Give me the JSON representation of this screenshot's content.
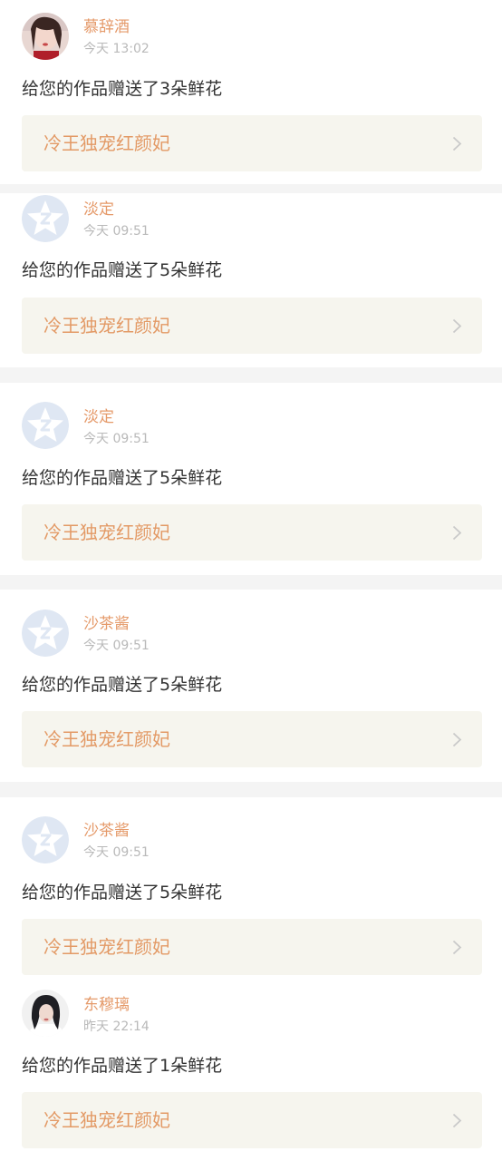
{
  "notifications": [
    {
      "username": "慕辞酒",
      "time": "今天 13:02",
      "message": "给您的作品赠送了3朵鲜花",
      "work_title": "冷王独宠红颜妃",
      "avatar": "photo-avatar-icon"
    },
    {
      "username": "淡定",
      "time": "今天 09:51",
      "message": "给您的作品赠送了5朵鲜花",
      "work_title": "冷王独宠红颜妃",
      "avatar": "default-star-avatar-icon"
    },
    {
      "username": "淡定",
      "time": "今天 09:51",
      "message": "给您的作品赠送了5朵鲜花",
      "work_title": "冷王独宠红颜妃",
      "avatar": "default-star-avatar-icon"
    },
    {
      "username": "沙茶酱",
      "time": "今天 09:51",
      "message": "给您的作品赠送了5朵鲜花",
      "work_title": "冷王独宠红颜妃",
      "avatar": "default-star-avatar-icon"
    },
    {
      "username": "沙茶酱",
      "time": "今天 09:51",
      "message": "给您的作品赠送了5朵鲜花",
      "work_title": "冷王独宠红颜妃",
      "avatar": "default-star-avatar-icon"
    },
    {
      "username": "东穆璃",
      "time": "昨天 22:14",
      "message": "给您的作品赠送了1朵鲜花",
      "work_title": "冷王独宠红颜妃",
      "avatar": "photo-avatar-icon"
    }
  ],
  "colors": {
    "username": "#e59a6a",
    "time": "#b9b9b9",
    "message": "#333333",
    "link_background": "#f6f5ee",
    "link_text": "#e39a66",
    "divider": "#f4f4f4"
  }
}
